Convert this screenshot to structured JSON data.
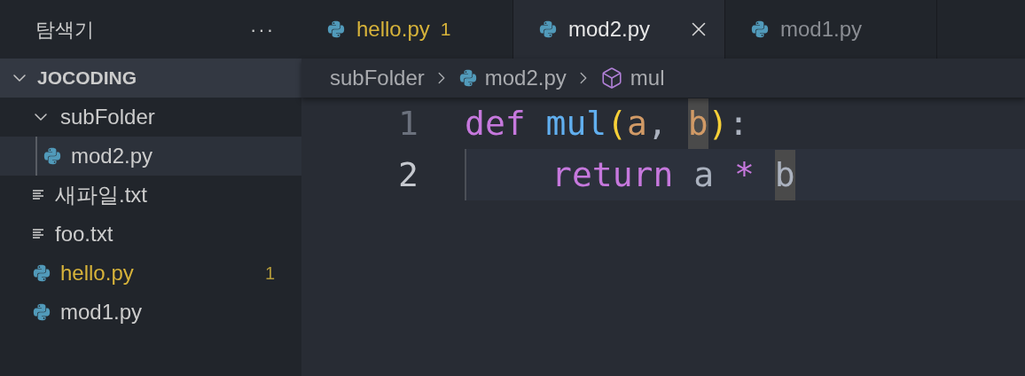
{
  "sidebar": {
    "title": "탐색기",
    "more": "···",
    "root": {
      "label": "JOCODING",
      "expanded": true,
      "children": [
        {
          "label": "subFolder",
          "kind": "folder",
          "expanded": true,
          "selected": false,
          "children": [
            {
              "label": "mod2.py",
              "kind": "python",
              "selected": true
            }
          ]
        },
        {
          "label": "새파일.txt",
          "kind": "text",
          "selected": false
        },
        {
          "label": "foo.txt",
          "kind": "text",
          "selected": false
        },
        {
          "label": "hello.py",
          "kind": "python",
          "selected": false,
          "problems": "1"
        },
        {
          "label": "mod1.py",
          "kind": "python",
          "selected": false
        }
      ]
    }
  },
  "tabs": [
    {
      "label": "hello.py",
      "selected": false,
      "problems": "1"
    },
    {
      "label": "mod2.py",
      "selected": true
    },
    {
      "label": "mod1.py",
      "selected": false
    }
  ],
  "breadcrumbs": [
    {
      "label": "subFolder",
      "kind": "folder"
    },
    {
      "label": "mod2.py",
      "kind": "python"
    },
    {
      "label": "mul",
      "kind": "symbol"
    }
  ],
  "code": [
    {
      "number": "1",
      "current": false,
      "tokens": [
        {
          "text": "def",
          "kind": "keyword"
        },
        {
          "text": "mul",
          "kind": "function",
          "space_before": true
        },
        {
          "text": "(",
          "kind": "bracket"
        },
        {
          "text": "a",
          "kind": "param"
        },
        {
          "text": ",",
          "kind": "plain"
        },
        {
          "text": "b",
          "kind": "param",
          "space_before": true,
          "highlighted": true
        },
        {
          "text": ")",
          "kind": "bracket"
        },
        {
          "text": ":",
          "kind": "plain"
        }
      ]
    },
    {
      "number": "2",
      "current": true,
      "indent": true,
      "tokens": [
        {
          "text": "return",
          "kind": "keyword"
        },
        {
          "text": "a",
          "kind": "plain",
          "space_before": true
        },
        {
          "text": "*",
          "kind": "keyword",
          "space_before": true
        },
        {
          "text": "b",
          "kind": "plain",
          "space_before": true,
          "highlighted": true
        }
      ]
    }
  ]
}
